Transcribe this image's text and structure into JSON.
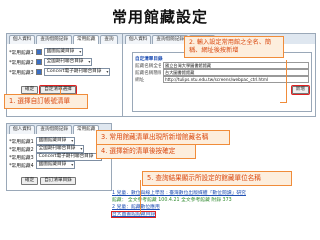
{
  "page_title": "常用館藏設定",
  "tabs": [
    "個人資料",
    "查詢借閱記錄",
    "常用館藏",
    "查詢"
  ],
  "tabs2": [
    "個人資料",
    "查詢借閱記錄",
    "常用館藏"
  ],
  "settings_rows": [
    {
      "label": "*常用館藏1",
      "value": "國圖館藏目錄",
      "checked": true
    },
    {
      "label": "*常用館藏2",
      "value": "全國期刊聯合目錄",
      "checked": true
    },
    {
      "label": "*常用館藏3",
      "value": "Concert電子期刊聯合目錄",
      "checked": true
    }
  ],
  "settings_rows2": [
    {
      "label": "*常用館藏1",
      "value": "國圖館藏目錄"
    },
    {
      "label": "*常用館藏2",
      "value": "全國期刊聯合目錄"
    },
    {
      "label": "*常用館藏3",
      "value": "Concert電子期刊聯合目錄"
    },
    {
      "label": "*常用館藏4",
      "value": "國圖館藏目錄"
    }
  ],
  "buttons": {
    "confirm": "確定",
    "clear": "清除",
    "add_custom": "自定清單選擇",
    "add_custom2": "自訂清單目錄"
  },
  "callouts": {
    "c1": "1. 選擇自訂帳號清單",
    "c2": "2. 輸入設定常用館之全名、簡稱、網址後按新增",
    "c3": "3. 常用館藏清單出現所新增館藏名稱",
    "c4": "4. 選擇新的清單後按確定",
    "c5": "5. 查詢結果顯示所設定的館藏單位名稱"
  },
  "form": {
    "title": "自定清單目錄",
    "rows": [
      {
        "label": "館藏名稱全名",
        "value": "國立台灣大學圖書館館藏"
      },
      {
        "label": "館藏名稱簡稱",
        "value": "台大圖書館館藏"
      },
      {
        "label": "網址",
        "value": "http://tulips.ntu.edu.tw/screens/webpac_ctrl.html"
      }
    ],
    "add_button": "新增"
  },
  "results": {
    "line1": "1  兒童．數位與線上學習 : 臺灣數位出版媒體「數位閱讀」研究",
    "line2": "館藏：  全文參考館藏 100.4.21  全文參考館藏 附錄 373",
    "line3": "2  兒童：館藏數位應用",
    "highlight": "台大圖書館館藏目錄"
  },
  "colors": {
    "callout_border": "#f08c3a",
    "callout_bg": "#fdeedd",
    "callout_text": "#d9480f",
    "highlight": "#e02020"
  }
}
